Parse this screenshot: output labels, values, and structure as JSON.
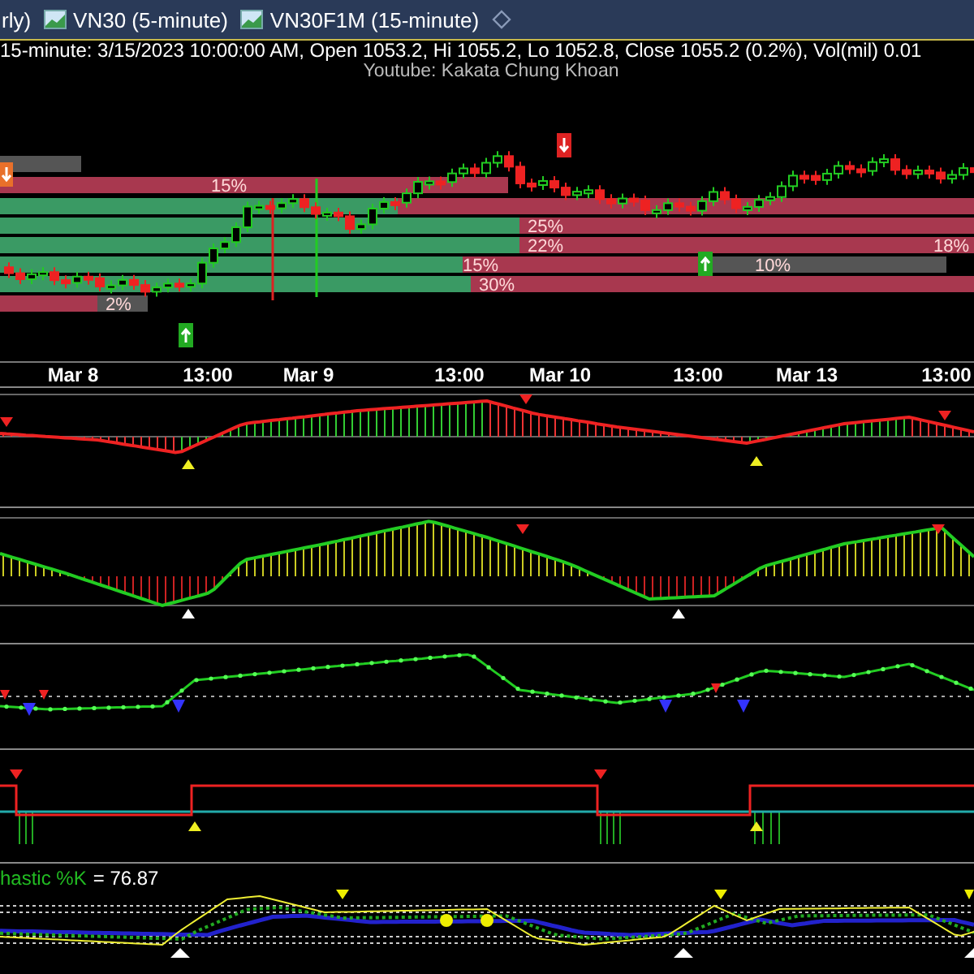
{
  "tabs": [
    {
      "label": "rly)",
      "icon": false
    },
    {
      "label": "VN30 (5-minute)",
      "icon": true
    },
    {
      "label": "VN30F1M (15-minute)",
      "icon": true
    }
  ],
  "info": {
    "quote": "15-minute: 3/15/2023 10:00:00 AM, Open 1053.2, Hi 1055.2, Lo 1052.8, Close 1055.2 (0.2%), Vol(mil) 0.01",
    "credit": "Youtube: Kakata Chung Khoan"
  },
  "chart": {
    "profile_labels": [
      "15%",
      "25%",
      "22%",
      "18%",
      "15%",
      "10%",
      "30%",
      "2%"
    ],
    "time_labels": [
      "Mar 8",
      "13:00",
      "Mar 9",
      "13:00",
      "Mar 10",
      "13:00",
      "Mar 13",
      "13:00"
    ]
  },
  "stochastic": {
    "label": "hastic %K",
    "value": "= 76.87"
  }
}
